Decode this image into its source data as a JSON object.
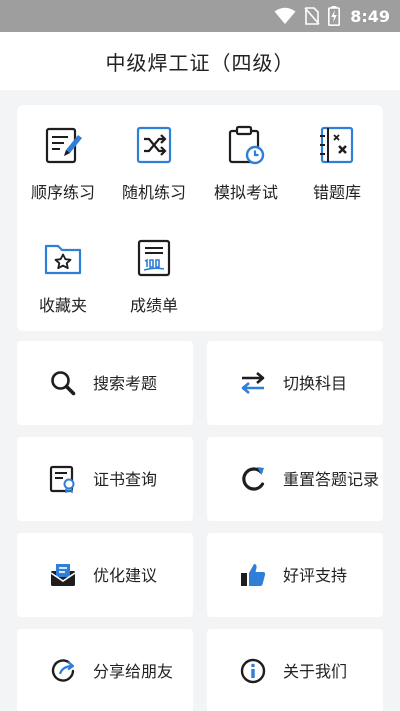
{
  "status_bar": {
    "time": "8:49",
    "icons": [
      "wifi-icon",
      "no-sim-icon",
      "battery-charging-icon"
    ]
  },
  "header": {
    "title": "中级焊工证（四级）"
  },
  "practice_grid": {
    "items": [
      {
        "label": "顺序练习",
        "icon": "sequential-practice-icon"
      },
      {
        "label": "随机练习",
        "icon": "shuffle-icon"
      },
      {
        "label": "模拟考试",
        "icon": "clipboard-clock-icon"
      },
      {
        "label": "错题库",
        "icon": "wrong-answers-book-icon"
      },
      {
        "label": "收藏夹",
        "icon": "favorites-folder-icon"
      },
      {
        "label": "成绩单",
        "icon": "score-report-icon"
      }
    ]
  },
  "tiles": [
    {
      "label": "搜索考题",
      "icon": "search-icon"
    },
    {
      "label": "切换科目",
      "icon": "swap-arrows-icon"
    },
    {
      "label": "证书查询",
      "icon": "certificate-icon"
    },
    {
      "label": "重置答题记录",
      "icon": "reset-icon"
    },
    {
      "label": "优化建议",
      "icon": "mail-icon"
    },
    {
      "label": "好评支持",
      "icon": "thumbs-up-icon"
    },
    {
      "label": "分享给朋友",
      "icon": "share-icon"
    },
    {
      "label": "关于我们",
      "icon": "info-icon"
    }
  ],
  "colors": {
    "accent": "#2f7fd8",
    "icon_dark": "#1e1e1e",
    "background": "#f3f4f6",
    "status_bar": "#9e9e9e"
  }
}
